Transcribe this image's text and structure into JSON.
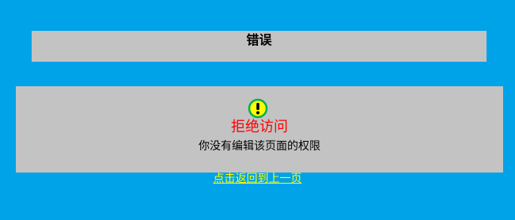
{
  "header": {
    "title": "错误"
  },
  "message": {
    "icon": "warning-icon",
    "heading": "拒绝访问",
    "detail": "你没有编辑该页面的权限"
  },
  "actions": {
    "back_link": "点击返回到上一页"
  },
  "colors": {
    "background": "#00a2e8",
    "panel": "#c3c3c3",
    "heading": "#ff0000",
    "link": "#ffff00",
    "icon_ring": "#00b050",
    "icon_fill": "#ffff00"
  }
}
